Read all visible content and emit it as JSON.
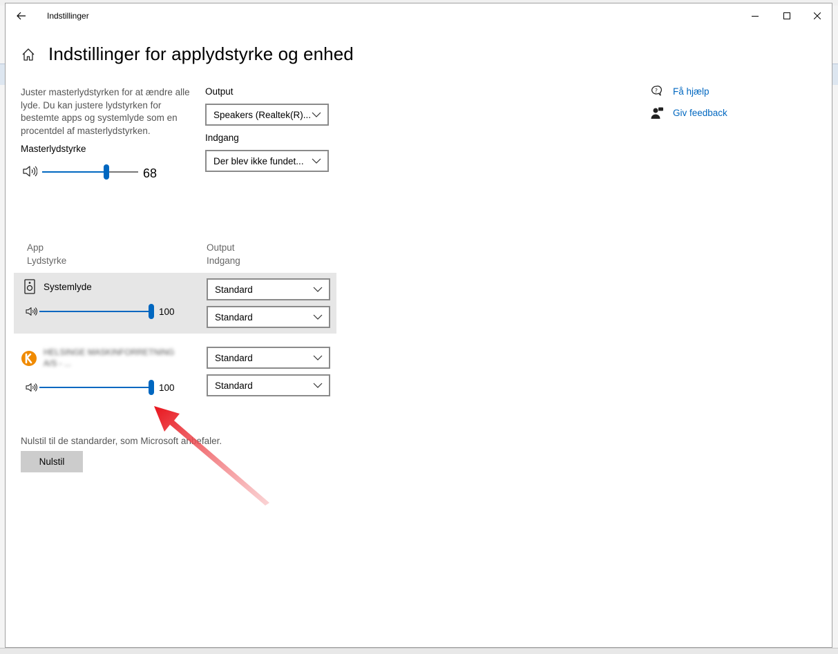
{
  "window": {
    "title": "Indstillinger"
  },
  "page": {
    "title": "Indstillinger for applydstyrke og enhed"
  },
  "master": {
    "description": "Juster masterlydstyrken for at ændre alle lyde. Du kan justere lydstyrken for bestemte apps og systemlyde som en procentdel af masterlydstyrken.",
    "label": "Masterlydstyrke",
    "value": "68",
    "level": 68
  },
  "device": {
    "output_label": "Output",
    "output_value": "Speakers (Realtek(R)...",
    "input_label": "Indgang",
    "input_value": "Der blev ikke fundet..."
  },
  "apps_table": {
    "col_app": "App",
    "col_volume": "Lydstyrke",
    "col_output": "Output",
    "col_input": "Indgang",
    "rows": [
      {
        "name": "Systemlyde",
        "volume": "100",
        "level": 100,
        "output": "Standard",
        "input": "Standard"
      },
      {
        "name": "HELSINGE MASKINFORRETNING A/S - ...",
        "volume": "100",
        "level": 100,
        "output": "Standard",
        "input": "Standard"
      }
    ]
  },
  "reset": {
    "text": "Nulstil til de standarder, som Microsoft anbefaler.",
    "button": "Nulstil"
  },
  "help": {
    "get_help": "Få hjælp",
    "feedback": "Giv feedback"
  },
  "colors": {
    "accent": "#0067c0",
    "selected_row": "#e6e6e6",
    "annotation_arrow": "#e8141c"
  }
}
